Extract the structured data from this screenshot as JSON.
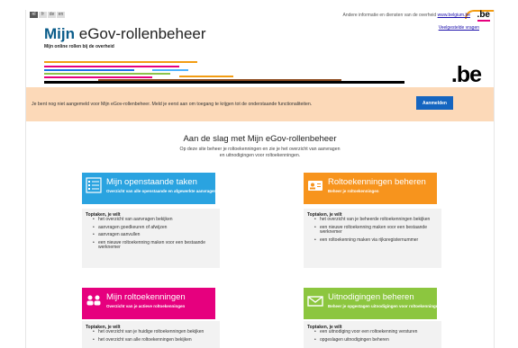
{
  "header": {
    "languages": [
      "nl",
      "fr",
      "de",
      "en"
    ],
    "top_info_prefix": "Andere informatie en diensten van de overheid",
    "top_info_link": "www.belgium.be",
    "be_logo": ".be",
    "faq_link": "Veelgestelde vragen",
    "title_part1": "Mijn",
    "title_part2": "eGov-rollenbeheer",
    "subtitle": "Mijn online rollen bij de overheid",
    "stripe_colors": [
      "#f39c12",
      "#e6007e",
      "#1a73e8",
      "#8bc34a",
      "#000000"
    ]
  },
  "banner": {
    "text": "Je bent nog niet aangemeld voor Mijn eGov-rollenbeheer. Meld je eerst aan om toegang te krijgen tot de onderstaande functionaliteiten.",
    "button_label": "Aanmelden"
  },
  "main": {
    "heading": "Aan de slag met Mijn eGov-rollenbeheer",
    "intro": "Op deze site beheer je roltoekenningen en zie je het overzicht van aanvragen en uitnodigingen voor roltoekenningen."
  },
  "cards": [
    {
      "title": "Mijn openstaande taken",
      "subtitle": "Overzicht van alle openstaande en afgewerkte aanvragen",
      "color": "#2aa3e0",
      "icon": "task-list-icon",
      "tasks_heading": "Toptaken, je wilt",
      "tasks": [
        "het overzicht van aanvragen bekijken",
        "aanvragen goedkeuren of afwijzen",
        "aanvragen aanvullen",
        "een nieuwe roltoekenning maken voor een bestaande werknemer"
      ]
    },
    {
      "title": "Roltoekenningen beheren",
      "subtitle": "Beheer je roltoekenningen",
      "color": "#f7941d",
      "icon": "id-card-icon",
      "tasks_heading": "Toptaken, je wilt",
      "tasks": [
        "het overzicht van je beheerde roltoekenningen bekijken",
        "een nieuwe roltoekenning maken voor een bestaande werknemer",
        "een roltoekenning maken via rijksregisternummer"
      ]
    },
    {
      "title": "Mijn roltoekenningen",
      "subtitle": "Overzicht van je actieve roltoekenningen",
      "color": "#e6007e",
      "icon": "users-icon",
      "tasks_heading": "Toptaken, je wilt",
      "tasks": [
        "het overzicht van je huidige roltoekenningen bekijken",
        "het overzicht van alle roltoekenningen bekijken"
      ]
    },
    {
      "title": "Uitnodigingen beheren",
      "subtitle": "Beheer je opgestagen uitnodigingen voor roltoekenningen",
      "color": "#8cc63f",
      "icon": "envelope-icon",
      "tasks_heading": "Toptaken, je wilt",
      "tasks": [
        "een uitnodiging voor een roltoekenning versturen",
        "opgeslagen uitnodigingen beheren"
      ]
    }
  ]
}
